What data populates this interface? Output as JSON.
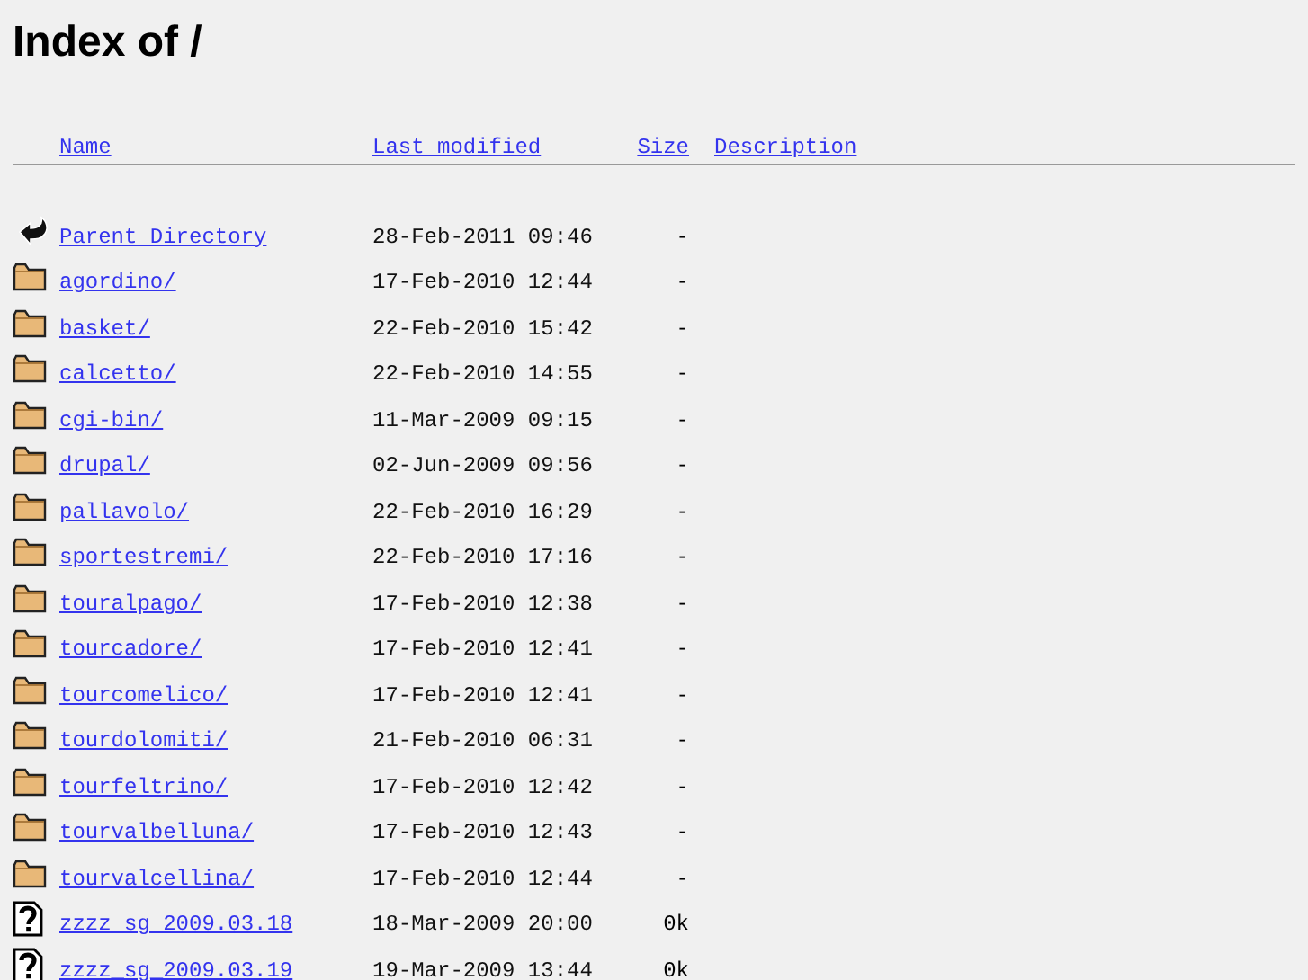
{
  "title": "Index of /",
  "columns": [
    "Name",
    "Last modified",
    "Size",
    "Description"
  ],
  "rows": [
    {
      "kind": "back",
      "name": "Parent Directory",
      "modified": "28-Feb-2011 09:46",
      "size": "-"
    },
    {
      "kind": "folder",
      "name": "agordino/",
      "modified": "17-Feb-2010 12:44",
      "size": "-"
    },
    {
      "kind": "folder",
      "name": "basket/",
      "modified": "22-Feb-2010 15:42",
      "size": "-"
    },
    {
      "kind": "folder",
      "name": "calcetto/",
      "modified": "22-Feb-2010 14:55",
      "size": "-"
    },
    {
      "kind": "folder",
      "name": "cgi-bin/",
      "modified": "11-Mar-2009 09:15",
      "size": "-"
    },
    {
      "kind": "folder",
      "name": "drupal/",
      "modified": "02-Jun-2009 09:56",
      "size": "-"
    },
    {
      "kind": "folder",
      "name": "pallavolo/",
      "modified": "22-Feb-2010 16:29",
      "size": "-"
    },
    {
      "kind": "folder",
      "name": "sportestremi/",
      "modified": "22-Feb-2010 17:16",
      "size": "-"
    },
    {
      "kind": "folder",
      "name": "touralpago/",
      "modified": "17-Feb-2010 12:38",
      "size": "-"
    },
    {
      "kind": "folder",
      "name": "tourcadore/",
      "modified": "17-Feb-2010 12:41",
      "size": "-"
    },
    {
      "kind": "folder",
      "name": "tourcomelico/",
      "modified": "17-Feb-2010 12:41",
      "size": "-"
    },
    {
      "kind": "folder",
      "name": "tourdolomiti/",
      "modified": "21-Feb-2010 06:31",
      "size": "-"
    },
    {
      "kind": "folder",
      "name": "tourfeltrino/",
      "modified": "17-Feb-2010 12:42",
      "size": "-"
    },
    {
      "kind": "folder",
      "name": "tourvalbelluna/",
      "modified": "17-Feb-2010 12:43",
      "size": "-"
    },
    {
      "kind": "folder",
      "name": "tourvalcellina/",
      "modified": "17-Feb-2010 12:44",
      "size": "-"
    },
    {
      "kind": "unknown",
      "name": "zzzz_sg_2009.03.18",
      "modified": "18-Mar-2009 20:00",
      "size": "0k"
    },
    {
      "kind": "unknown",
      "name": "zzzz_sg_2009.03.19",
      "modified": "19-Mar-2009 13:44",
      "size": "0k"
    }
  ]
}
